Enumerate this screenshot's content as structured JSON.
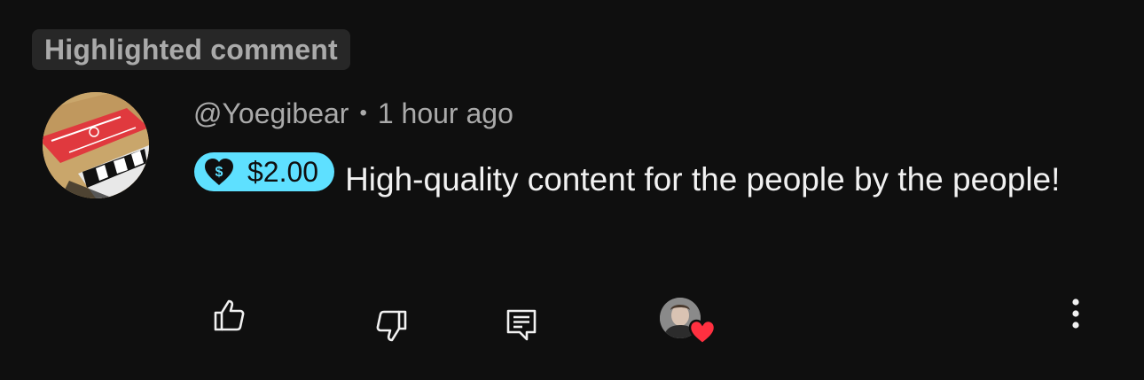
{
  "header": {
    "badge_label": "Highlighted comment"
  },
  "comment": {
    "author": "@Yoegibear",
    "separator": "•",
    "timestamp": "1 hour ago",
    "super_thanks_amount": "$2.00",
    "super_thanks_color": "#5ee0ff",
    "text": "High-quality content for the people by the people!"
  },
  "actions": {
    "like_icon": "thumbs-up-icon",
    "dislike_icon": "thumbs-down-icon",
    "reply_icon": "reply-icon",
    "creator_heart_color": "#ff3040",
    "more_icon": "more-vert-icon"
  }
}
